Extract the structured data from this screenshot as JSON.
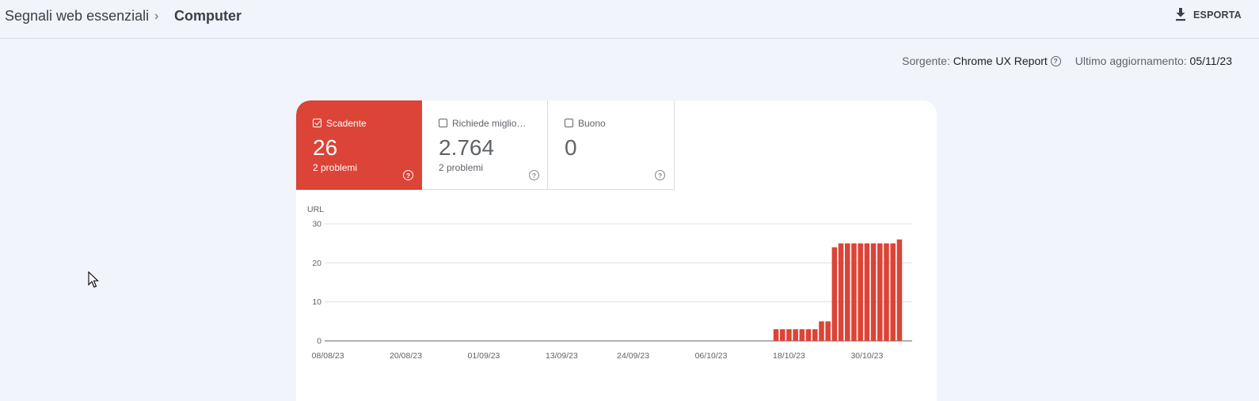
{
  "breadcrumb": {
    "root": "Segnali web essenziali",
    "separator": "›",
    "current": "Computer"
  },
  "toolbar": {
    "export_label": "ESPORTA",
    "export_icon": "download-icon"
  },
  "meta": {
    "source_label": "Sorgente:",
    "source_value": "Chrome UX Report",
    "updated_label": "Ultimo aggiornamento:",
    "updated_value": "05/11/23"
  },
  "tiles": [
    {
      "label": "Scadente",
      "count": "26",
      "sub": "2 problemi",
      "checked": true,
      "color": "#db4437"
    },
    {
      "label": "Richiede miglioramento",
      "count": "2.764",
      "sub": "2 problemi",
      "checked": false
    },
    {
      "label": "Buono",
      "count": "0",
      "sub": "",
      "checked": false
    }
  ],
  "colors": {
    "poor": "#db4437",
    "background": "#f1f4fa"
  },
  "chart_data": {
    "type": "bar",
    "ylabel": "URL",
    "ylim": [
      0,
      30
    ],
    "yticks": [
      0,
      10,
      20,
      30
    ],
    "xticks": [
      "08/08/23",
      "20/08/23",
      "01/09/23",
      "13/09/23",
      "24/09/23",
      "06/10/23",
      "18/10/23",
      "30/10/23"
    ],
    "grid": true,
    "x_start": "08/08/23",
    "x_end": "04/11/23",
    "series": [
      {
        "color": "#db4437",
        "points": [
          {
            "x": "16/10/23",
            "y": 3
          },
          {
            "x": "17/10/23",
            "y": 3
          },
          {
            "x": "18/10/23",
            "y": 3
          },
          {
            "x": "19/10/23",
            "y": 3
          },
          {
            "x": "20/10/23",
            "y": 3
          },
          {
            "x": "21/10/23",
            "y": 3
          },
          {
            "x": "22/10/23",
            "y": 3
          },
          {
            "x": "23/10/23",
            "y": 5
          },
          {
            "x": "24/10/23",
            "y": 5
          },
          {
            "x": "25/10/23",
            "y": 24
          },
          {
            "x": "26/10/23",
            "y": 25
          },
          {
            "x": "27/10/23",
            "y": 25
          },
          {
            "x": "28/10/23",
            "y": 25
          },
          {
            "x": "29/10/23",
            "y": 25
          },
          {
            "x": "30/10/23",
            "y": 25
          },
          {
            "x": "31/10/23",
            "y": 25
          },
          {
            "x": "01/11/23",
            "y": 25
          },
          {
            "x": "02/11/23",
            "y": 25
          },
          {
            "x": "03/11/23",
            "y": 25
          },
          {
            "x": "04/11/23",
            "y": 26
          }
        ]
      }
    ]
  }
}
